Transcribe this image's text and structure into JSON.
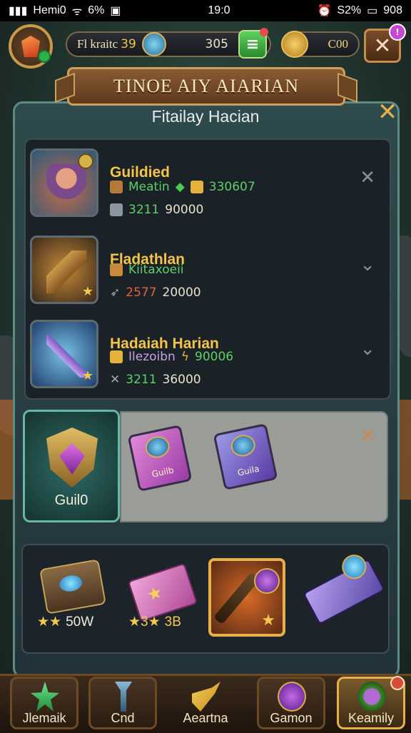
{
  "status_bar": {
    "carrier": "Hemi0",
    "wifi_percent": "6%",
    "time": "19:0",
    "battery_percent": "S2%",
    "right_value": "908"
  },
  "hud": {
    "player_label": "Fl kraitc",
    "player_num": "39",
    "gem_count": "305",
    "gold_count": "C00",
    "plus_label": "≡",
    "close_label": "✕",
    "close_badge": "!"
  },
  "banner": {
    "title": "TINOE AIY AIARIAN",
    "subtitle": "Fitailay Hacian"
  },
  "list": {
    "items": [
      {
        "name": "Guildied",
        "line1_a": "Meatin",
        "line1_b": "330607",
        "line2_a": "3211",
        "line2_b": "90000",
        "action": "✕"
      },
      {
        "name": "Fladathlan",
        "line1_a": "Kiitaxoeii",
        "line1_b": "",
        "line2_a": "2577",
        "line2_b": "20000",
        "action": "⌄"
      },
      {
        "name": "Hadaiah Harian",
        "line1_a": "Ilezoibn",
        "line1_b": "90006",
        "line2_a": "3211",
        "line2_b": "36000",
        "action": "⌄"
      }
    ]
  },
  "guild": {
    "label": "Guil0",
    "book1": "Guilb",
    "book2": "Guila",
    "close": "✕"
  },
  "inventory": {
    "item1_stars": "★★",
    "item1_text": "50W",
    "item2_stars": "★3★",
    "item2_text": "3B"
  },
  "nav": [
    {
      "label": "Jlemaik"
    },
    {
      "label": "Cnd"
    },
    {
      "label": "Aeartna"
    },
    {
      "label": "Gamon"
    },
    {
      "label": "Keamily"
    }
  ],
  "colors": {
    "accent_gold": "#f4c44a",
    "positive_green": "#5ed068",
    "negative_red": "#e2623e"
  }
}
